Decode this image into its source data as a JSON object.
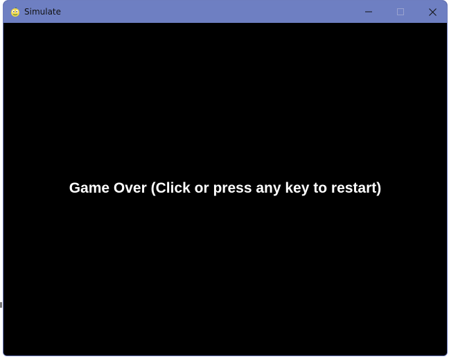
{
  "window": {
    "title": "Simulate",
    "app_icon": "pygame-snake-icon",
    "controls": {
      "minimize_icon": "minimize-icon",
      "maximize_icon": "maximize-icon",
      "close_icon": "close-icon"
    }
  },
  "game": {
    "message": "Game Over (Click or press any key to restart)"
  },
  "colors": {
    "titlebar": "#6e7fc2",
    "canvas_background": "#000000",
    "message_text": "#ffffff"
  }
}
